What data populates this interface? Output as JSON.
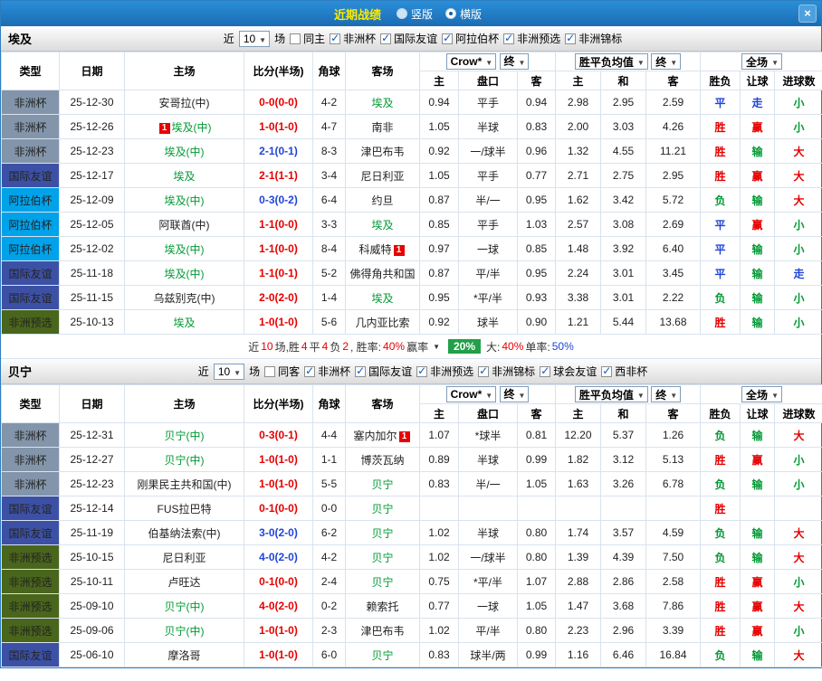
{
  "topbar": {
    "title": "近期战绩",
    "radio_vertical": "竖版",
    "radio_horizontal": "横版",
    "close": "×"
  },
  "type_colors": {
    "非洲杯": "#8395aa",
    "国际友谊": "#3c51a5",
    "阿拉伯杯": "#00a2e9",
    "非洲预选": "#49661c"
  },
  "result_colors": {
    "red": "#e60000",
    "green": "#009933",
    "blue": "#2045d8"
  },
  "table": {
    "col_headers": [
      "类型",
      "日期",
      "主场",
      "比分(半场)",
      "角球",
      "客场"
    ],
    "odds_company": "Crow*",
    "final_label": "终",
    "avg_label": "胜平负均值",
    "full_label": "全场",
    "odds_subheaders": [
      "主",
      "盘口",
      "客"
    ],
    "avg_subheaders": [
      "主",
      "和",
      "客"
    ],
    "result_subheaders": [
      "胜负",
      "让球",
      "进球数"
    ]
  },
  "sections": [
    {
      "team": "埃及",
      "filter": {
        "near_label": "近",
        "count": "10",
        "games_label": "场",
        "same": {
          "label": "同主",
          "checked": false
        },
        "leagues": [
          {
            "label": "非洲杯",
            "checked": true
          },
          {
            "label": "国际友谊",
            "checked": true
          },
          {
            "label": "阿拉伯杯",
            "checked": true
          },
          {
            "label": "非洲预选",
            "checked": true
          },
          {
            "label": "非洲锦标",
            "checked": true
          }
        ]
      },
      "rows": [
        {
          "type": "非洲杯",
          "date": "25-12-30",
          "home": {
            "name": "安哥拉(中)",
            "focus": false
          },
          "score": {
            "t": "0-0(0-0)",
            "c": "red"
          },
          "corner": "4-2",
          "away": {
            "name": "埃及",
            "focus": true
          },
          "odds": [
            "0.94",
            "平手",
            "0.94"
          ],
          "avg": [
            "2.98",
            "2.95",
            "2.59"
          ],
          "results": [
            {
              "t": "平",
              "c": "blue"
            },
            {
              "t": "走",
              "c": "blue"
            },
            {
              "t": "小",
              "c": "green"
            }
          ]
        },
        {
          "type": "非洲杯",
          "date": "25-12-26",
          "home": {
            "name": "埃及(中)",
            "focus": true,
            "badge_pre": "1"
          },
          "score": {
            "t": "1-0(1-0)",
            "c": "red"
          },
          "corner": "4-7",
          "away": {
            "name": "南非",
            "focus": false
          },
          "odds": [
            "1.05",
            "半球",
            "0.83"
          ],
          "avg": [
            "2.00",
            "3.03",
            "4.26"
          ],
          "results": [
            {
              "t": "胜",
              "c": "red"
            },
            {
              "t": "赢",
              "c": "red"
            },
            {
              "t": "小",
              "c": "green"
            }
          ]
        },
        {
          "type": "非洲杯",
          "date": "25-12-23",
          "home": {
            "name": "埃及(中)",
            "focus": true
          },
          "score": {
            "t": "2-1(0-1)",
            "c": "blue"
          },
          "corner": "8-3",
          "away": {
            "name": "津巴布韦",
            "focus": false
          },
          "odds": [
            "0.92",
            "一/球半",
            "0.96"
          ],
          "avg": [
            "1.32",
            "4.55",
            "11.21"
          ],
          "results": [
            {
              "t": "胜",
              "c": "red"
            },
            {
              "t": "输",
              "c": "green"
            },
            {
              "t": "大",
              "c": "red"
            }
          ]
        },
        {
          "type": "国际友谊",
          "date": "25-12-17",
          "home": {
            "name": "埃及",
            "focus": true
          },
          "score": {
            "t": "2-1(1-1)",
            "c": "red"
          },
          "corner": "3-4",
          "away": {
            "name": "尼日利亚",
            "focus": false
          },
          "odds": [
            "1.05",
            "平手",
            "0.77"
          ],
          "avg": [
            "2.71",
            "2.75",
            "2.95"
          ],
          "results": [
            {
              "t": "胜",
              "c": "red"
            },
            {
              "t": "赢",
              "c": "red"
            },
            {
              "t": "大",
              "c": "red"
            }
          ]
        },
        {
          "type": "阿拉伯杯",
          "date": "25-12-09",
          "home": {
            "name": "埃及(中)",
            "focus": true
          },
          "score": {
            "t": "0-3(0-2)",
            "c": "blue"
          },
          "corner": "6-4",
          "away": {
            "name": "约旦",
            "focus": false
          },
          "odds": [
            "0.87",
            "半/一",
            "0.95"
          ],
          "avg": [
            "1.62",
            "3.42",
            "5.72"
          ],
          "results": [
            {
              "t": "负",
              "c": "green"
            },
            {
              "t": "输",
              "c": "green"
            },
            {
              "t": "大",
              "c": "red"
            }
          ]
        },
        {
          "type": "阿拉伯杯",
          "date": "25-12-05",
          "home": {
            "name": "阿联酋(中)",
            "focus": false
          },
          "score": {
            "t": "1-1(0-0)",
            "c": "red"
          },
          "corner": "3-3",
          "away": {
            "name": "埃及",
            "focus": true
          },
          "odds": [
            "0.85",
            "平手",
            "1.03"
          ],
          "avg": [
            "2.57",
            "3.08",
            "2.69"
          ],
          "results": [
            {
              "t": "平",
              "c": "blue"
            },
            {
              "t": "赢",
              "c": "red"
            },
            {
              "t": "小",
              "c": "green"
            }
          ]
        },
        {
          "type": "阿拉伯杯",
          "date": "25-12-02",
          "home": {
            "name": "埃及(中)",
            "focus": true
          },
          "score": {
            "t": "1-1(0-0)",
            "c": "red"
          },
          "corner": "8-4",
          "away": {
            "name": "科威特",
            "focus": false,
            "badge_post": "1"
          },
          "odds": [
            "0.97",
            "一球",
            "0.85"
          ],
          "avg": [
            "1.48",
            "3.92",
            "6.40"
          ],
          "results": [
            {
              "t": "平",
              "c": "blue"
            },
            {
              "t": "输",
              "c": "green"
            },
            {
              "t": "小",
              "c": "green"
            }
          ]
        },
        {
          "type": "国际友谊",
          "date": "25-11-18",
          "home": {
            "name": "埃及(中)",
            "focus": true
          },
          "score": {
            "t": "1-1(0-1)",
            "c": "red"
          },
          "corner": "5-2",
          "away": {
            "name": "佛得角共和国",
            "focus": false
          },
          "odds": [
            "0.87",
            "平/半",
            "0.95"
          ],
          "avg": [
            "2.24",
            "3.01",
            "3.45"
          ],
          "results": [
            {
              "t": "平",
              "c": "blue"
            },
            {
              "t": "输",
              "c": "green"
            },
            {
              "t": "走",
              "c": "blue"
            }
          ]
        },
        {
          "type": "国际友谊",
          "date": "25-11-15",
          "home": {
            "name": "乌兹别克(中)",
            "focus": false
          },
          "score": {
            "t": "2-0(2-0)",
            "c": "red"
          },
          "corner": "1-4",
          "away": {
            "name": "埃及",
            "focus": true
          },
          "odds": [
            "0.95",
            "*平/半",
            "0.93"
          ],
          "avg": [
            "3.38",
            "3.01",
            "2.22"
          ],
          "results": [
            {
              "t": "负",
              "c": "green"
            },
            {
              "t": "输",
              "c": "green"
            },
            {
              "t": "小",
              "c": "green"
            }
          ]
        },
        {
          "type": "非洲预选",
          "date": "25-10-13",
          "home": {
            "name": "埃及",
            "focus": true
          },
          "score": {
            "t": "1-0(1-0)",
            "c": "red"
          },
          "corner": "5-6",
          "away": {
            "name": "几内亚比索",
            "focus": false
          },
          "odds": [
            "0.92",
            "球半",
            "0.90"
          ],
          "avg": [
            "1.21",
            "5.44",
            "13.68"
          ],
          "results": [
            {
              "t": "胜",
              "c": "red"
            },
            {
              "t": "输",
              "c": "green"
            },
            {
              "t": "小",
              "c": "green"
            }
          ]
        }
      ],
      "summary_segments": [
        {
          "t": "近",
          "c": "k"
        },
        {
          "t": "10",
          "c": "r"
        },
        {
          "t": "场,胜",
          "c": "k"
        },
        {
          "t": "4",
          "c": "r"
        },
        {
          "t": "平",
          "c": "k"
        },
        {
          "t": "4",
          "c": "r"
        },
        {
          "t": "负",
          "c": "k"
        },
        {
          "t": "2",
          "c": "r"
        },
        {
          "t": ", 胜率:",
          "c": "k"
        },
        {
          "t": "40%",
          "c": "r"
        },
        {
          "t": " 赢率",
          "c": "k"
        },
        {
          "t": "▼",
          "c": "arr"
        },
        {
          "t": "20%",
          "c": "badge"
        },
        {
          "t": " 大:",
          "c": "k"
        },
        {
          "t": "40%",
          "c": "r"
        },
        {
          "t": " 单率:",
          "c": "k"
        },
        {
          "t": "50%",
          "c": "b"
        }
      ]
    },
    {
      "team": "贝宁",
      "filter": {
        "near_label": "近",
        "count": "10",
        "games_label": "场",
        "same": {
          "label": "同客",
          "checked": false
        },
        "leagues": [
          {
            "label": "非洲杯",
            "checked": true
          },
          {
            "label": "国际友谊",
            "checked": true
          },
          {
            "label": "非洲预选",
            "checked": true
          },
          {
            "label": "非洲锦标",
            "checked": true
          },
          {
            "label": "球会友谊",
            "checked": true
          },
          {
            "label": "西非杯",
            "checked": true
          }
        ]
      },
      "rows": [
        {
          "type": "非洲杯",
          "date": "25-12-31",
          "home": {
            "name": "贝宁(中)",
            "focus": true
          },
          "score": {
            "t": "0-3(0-1)",
            "c": "red"
          },
          "corner": "4-4",
          "away": {
            "name": "塞内加尔",
            "focus": false,
            "badge_post": "1"
          },
          "odds": [
            "1.07",
            "*球半",
            "0.81"
          ],
          "avg": [
            "12.20",
            "5.37",
            "1.26"
          ],
          "results": [
            {
              "t": "负",
              "c": "green"
            },
            {
              "t": "输",
              "c": "green"
            },
            {
              "t": "大",
              "c": "red"
            }
          ]
        },
        {
          "type": "非洲杯",
          "date": "25-12-27",
          "home": {
            "name": "贝宁(中)",
            "focus": true
          },
          "score": {
            "t": "1-0(1-0)",
            "c": "red"
          },
          "corner": "1-1",
          "away": {
            "name": "博茨瓦纳",
            "focus": false
          },
          "odds": [
            "0.89",
            "半球",
            "0.99"
          ],
          "avg": [
            "1.82",
            "3.12",
            "5.13"
          ],
          "results": [
            {
              "t": "胜",
              "c": "red"
            },
            {
              "t": "赢",
              "c": "red"
            },
            {
              "t": "小",
              "c": "green"
            }
          ]
        },
        {
          "type": "非洲杯",
          "date": "25-12-23",
          "home": {
            "name": "刚果民主共和国(中)",
            "focus": false
          },
          "score": {
            "t": "1-0(1-0)",
            "c": "red"
          },
          "corner": "5-5",
          "away": {
            "name": "贝宁",
            "focus": true
          },
          "odds": [
            "0.83",
            "半/一",
            "1.05"
          ],
          "avg": [
            "1.63",
            "3.26",
            "6.78"
          ],
          "results": [
            {
              "t": "负",
              "c": "green"
            },
            {
              "t": "输",
              "c": "green"
            },
            {
              "t": "小",
              "c": "green"
            }
          ]
        },
        {
          "type": "国际友谊",
          "date": "25-12-14",
          "home": {
            "name": "FUS拉巴特",
            "focus": false
          },
          "score": {
            "t": "0-1(0-0)",
            "c": "red"
          },
          "corner": "0-0",
          "away": {
            "name": "贝宁",
            "focus": true
          },
          "odds": [
            "",
            "",
            ""
          ],
          "avg": [
            "",
            "",
            ""
          ],
          "results": [
            {
              "t": "胜",
              "c": "red"
            },
            {
              "t": "",
              "c": ""
            },
            {
              "t": "",
              "c": ""
            }
          ]
        },
        {
          "type": "国际友谊",
          "date": "25-11-19",
          "home": {
            "name": "伯基纳法索(中)",
            "focus": false
          },
          "score": {
            "t": "3-0(2-0)",
            "c": "blue"
          },
          "corner": "6-2",
          "away": {
            "name": "贝宁",
            "focus": true
          },
          "odds": [
            "1.02",
            "半球",
            "0.80"
          ],
          "avg": [
            "1.74",
            "3.57",
            "4.59"
          ],
          "results": [
            {
              "t": "负",
              "c": "green"
            },
            {
              "t": "输",
              "c": "green"
            },
            {
              "t": "大",
              "c": "red"
            }
          ]
        },
        {
          "type": "非洲预选",
          "date": "25-10-15",
          "home": {
            "name": "尼日利亚",
            "focus": false
          },
          "score": {
            "t": "4-0(2-0)",
            "c": "blue"
          },
          "corner": "4-2",
          "away": {
            "name": "贝宁",
            "focus": true
          },
          "odds": [
            "1.02",
            "一/球半",
            "0.80"
          ],
          "avg": [
            "1.39",
            "4.39",
            "7.50"
          ],
          "results": [
            {
              "t": "负",
              "c": "green"
            },
            {
              "t": "输",
              "c": "green"
            },
            {
              "t": "大",
              "c": "red"
            }
          ]
        },
        {
          "type": "非洲预选",
          "date": "25-10-11",
          "home": {
            "name": "卢旺达",
            "focus": false
          },
          "score": {
            "t": "0-1(0-0)",
            "c": "red"
          },
          "corner": "2-4",
          "away": {
            "name": "贝宁",
            "focus": true
          },
          "odds": [
            "0.75",
            "*平/半",
            "1.07"
          ],
          "avg": [
            "2.88",
            "2.86",
            "2.58"
          ],
          "results": [
            {
              "t": "胜",
              "c": "red"
            },
            {
              "t": "赢",
              "c": "red"
            },
            {
              "t": "小",
              "c": "green"
            }
          ]
        },
        {
          "type": "非洲预选",
          "date": "25-09-10",
          "home": {
            "name": "贝宁(中)",
            "focus": true
          },
          "score": {
            "t": "4-0(2-0)",
            "c": "red"
          },
          "corner": "0-2",
          "away": {
            "name": "赖索托",
            "focus": false
          },
          "odds": [
            "0.77",
            "一球",
            "1.05"
          ],
          "avg": [
            "1.47",
            "3.68",
            "7.86"
          ],
          "results": [
            {
              "t": "胜",
              "c": "red"
            },
            {
              "t": "赢",
              "c": "red"
            },
            {
              "t": "大",
              "c": "red"
            }
          ]
        },
        {
          "type": "非洲预选",
          "date": "25-09-06",
          "home": {
            "name": "贝宁(中)",
            "focus": true
          },
          "score": {
            "t": "1-0(1-0)",
            "c": "red"
          },
          "corner": "2-3",
          "away": {
            "name": "津巴布韦",
            "focus": false
          },
          "odds": [
            "1.02",
            "平/半",
            "0.80"
          ],
          "avg": [
            "2.23",
            "2.96",
            "3.39"
          ],
          "results": [
            {
              "t": "胜",
              "c": "red"
            },
            {
              "t": "赢",
              "c": "red"
            },
            {
              "t": "小",
              "c": "green"
            }
          ]
        },
        {
          "type": "国际友谊",
          "date": "25-06-10",
          "home": {
            "name": "摩洛哥",
            "focus": false
          },
          "score": {
            "t": "1-0(1-0)",
            "c": "red"
          },
          "corner": "6-0",
          "away": {
            "name": "贝宁",
            "focus": true
          },
          "odds": [
            "0.83",
            "球半/两",
            "0.99"
          ],
          "avg": [
            "1.16",
            "6.46",
            "16.84"
          ],
          "results": [
            {
              "t": "负",
              "c": "green"
            },
            {
              "t": "输",
              "c": "green"
            },
            {
              "t": "大",
              "c": "red"
            }
          ]
        }
      ],
      "summary_segments": null
    }
  ]
}
